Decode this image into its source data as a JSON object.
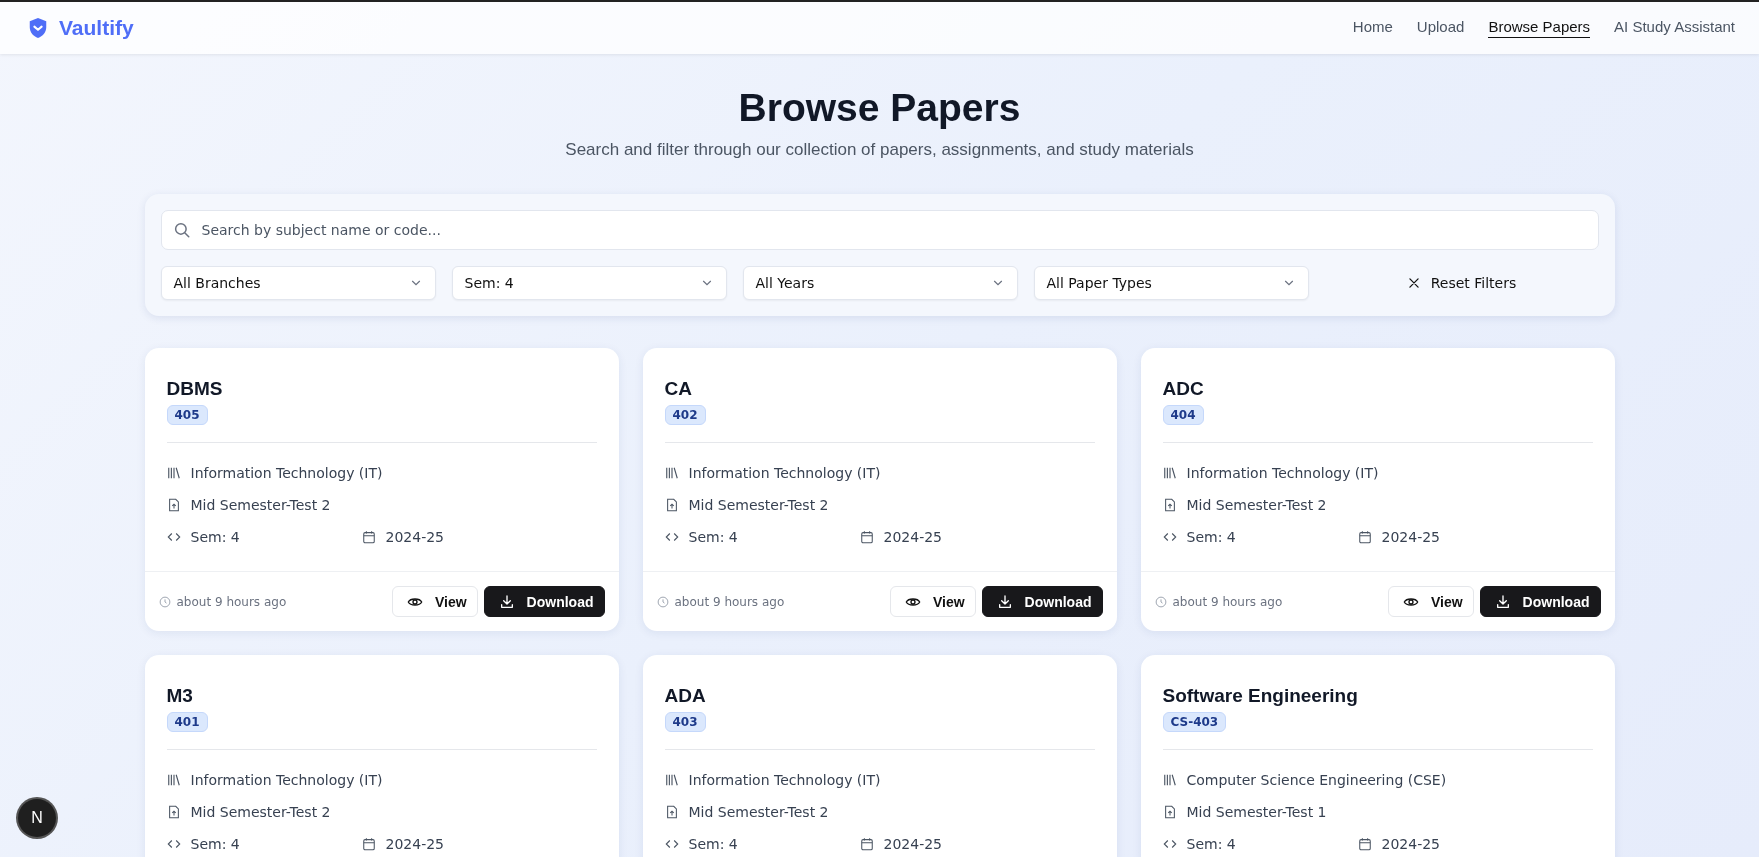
{
  "brand": "Vaultify",
  "nav": [
    {
      "label": "Home",
      "selected": false
    },
    {
      "label": "Upload",
      "selected": false
    },
    {
      "label": "Browse Papers",
      "selected": true
    },
    {
      "label": "AI Study Assistant",
      "selected": false
    }
  ],
  "heading": "Browse Papers",
  "subheading": "Search and filter through our collection of papers, assignments, and study materials",
  "search": {
    "placeholder": "Search by subject name or code..."
  },
  "filters": [
    "All Branches",
    "Sem: 4",
    "All Years",
    "All Paper Types"
  ],
  "reset_label": "Reset Filters",
  "cards": [
    {
      "title": "DBMS",
      "code": "405",
      "branch": "Information Technology (IT)",
      "exam": "Mid Semester-Test 2",
      "sem": "Sem: 4",
      "year": "2024-25",
      "posted": "about 9 hours ago",
      "view": "View",
      "download": "Download"
    },
    {
      "title": "CA",
      "code": "402",
      "branch": "Information Technology (IT)",
      "exam": "Mid Semester-Test 2",
      "sem": "Sem: 4",
      "year": "2024-25",
      "posted": "about 9 hours ago",
      "view": "View",
      "download": "Download"
    },
    {
      "title": "ADC",
      "code": "404",
      "branch": "Information Technology (IT)",
      "exam": "Mid Semester-Test 2",
      "sem": "Sem: 4",
      "year": "2024-25",
      "posted": "about 9 hours ago",
      "view": "View",
      "download": "Download"
    },
    {
      "title": "M3",
      "code": "401",
      "branch": "Information Technology (IT)",
      "exam": "Mid Semester-Test 2",
      "sem": "Sem: 4",
      "year": "2024-25"
    },
    {
      "title": "ADA",
      "code": "403",
      "branch": "Information Technology (IT)",
      "exam": "Mid Semester-Test 2",
      "sem": "Sem: 4",
      "year": "2024-25"
    },
    {
      "title": "Software Engineering",
      "code": "CS-403",
      "branch": "Computer Science Engineering (CSE)",
      "exam": "Mid Semester-Test 1",
      "sem": "Sem: 4",
      "year": "2024-25"
    }
  ],
  "dev_badge": "N"
}
